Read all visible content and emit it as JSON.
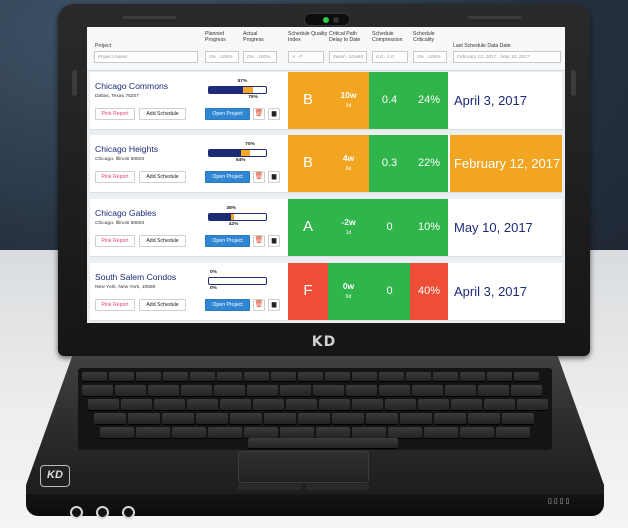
{
  "brand": {
    "lid_logo": "KD",
    "badge": "KD"
  },
  "header": {
    "columns": [
      {
        "label": "Project",
        "field": "Project Name"
      },
      {
        "label": "Planned Progress",
        "field": "0% - 100%"
      },
      {
        "label": "Actual Progress",
        "field": "0% - 100%"
      },
      {
        "label": "Schedule Quality Index",
        "field": "A - F"
      },
      {
        "label": "Critical Path Delay to Date",
        "field": "0w0d - 52w6d"
      },
      {
        "label": "Schedule Compression",
        "field": "0.0 - 1.0"
      },
      {
        "label": "Schedule Criticality",
        "field": "0% - 100%"
      },
      {
        "label": "Last Schedule Data Date",
        "field": "February 12, 2017 - May 10, 2017"
      }
    ]
  },
  "buttons": {
    "pink": "Pink Report",
    "add": "Add Schedule",
    "open": "Open Project"
  },
  "rows": [
    {
      "name": "Chicago Commons",
      "address": "Dallas, Texas 75207",
      "planned": "57%",
      "actual": "75%",
      "planned_frac": 0.57,
      "actual_frac": 0.75,
      "grade": "B",
      "delay": "10w",
      "delay_sub": "5d",
      "compression": "0.4",
      "criticality": "24%",
      "date": "April 3, 2017",
      "grade_color": "#f2a521",
      "delay_color": "#f2a521",
      "comp_color": "#2fb54a",
      "crit_color": "#2fb54a",
      "date_color": "#ffffff"
    },
    {
      "name": "Chicago Heights",
      "address": "Chicago, Illinois 60604",
      "planned": "70%",
      "actual": "54%",
      "planned_frac": 0.7,
      "actual_frac": 0.54,
      "grade": "B",
      "delay": "4w",
      "delay_sub": "6d",
      "compression": "0.3",
      "criticality": "22%",
      "date": "February 12, 2017",
      "grade_color": "#f2a521",
      "delay_color": "#f2a521",
      "comp_color": "#2fb54a",
      "crit_color": "#2fb54a",
      "date_color": "#f2a521"
    },
    {
      "name": "Chicago Gables",
      "address": "Chicago, Illinois 60604",
      "planned": "38%",
      "actual": "42%",
      "planned_frac": 0.38,
      "actual_frac": 0.42,
      "grade": "A",
      "delay": "-2w",
      "delay_sub": "1d",
      "compression": "0",
      "criticality": "10%",
      "date": "May 10, 2017",
      "grade_color": "#2fb54a",
      "delay_color": "#2fb54a",
      "comp_color": "#2fb54a",
      "crit_color": "#2fb54a",
      "date_color": "#ffffff"
    },
    {
      "name": "South Salem Condos",
      "address": "New York, New York, 10590",
      "planned": "0%",
      "actual": "0%",
      "planned_frac": 0.0,
      "actual_frac": 0.0,
      "grade": "F",
      "delay": "0w",
      "delay_sub": "6d",
      "compression": "0",
      "criticality": "40%",
      "date": "April 3, 2017",
      "grade_color": "#ef4e36",
      "delay_color": "#2fb54a",
      "comp_color": "#2fb54a",
      "crit_color": "#ef4e36",
      "date_color": "#ffffff"
    }
  ]
}
